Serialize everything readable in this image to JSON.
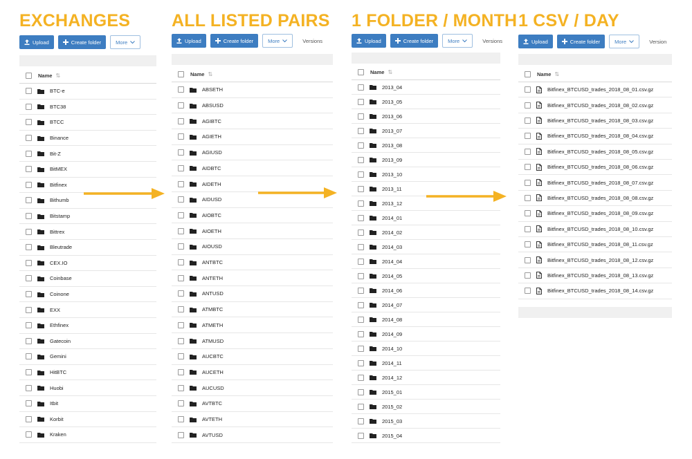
{
  "panels": [
    {
      "title": "EXCHANGES",
      "upload": "Upload",
      "create_folder": "Create folder",
      "more": "More",
      "versions": "",
      "name_header": "Name",
      "item_icon": "folder-icon",
      "items": [
        "BTC-e",
        "BTC38",
        "BTCC",
        "Binance",
        "Bit-Z",
        "BitMEX",
        "Bitfinex",
        "Bithumb",
        "Bitstamp",
        "Bittrex",
        "Bleutrade",
        "CEX.IO",
        "Coinbase",
        "Coinone",
        "EXX",
        "Ethfinex",
        "Gatecoin",
        "Gemini",
        "HitBTC",
        "Huobi",
        "Itbit",
        "Korbit",
        "Kraken"
      ]
    },
    {
      "title": "ALL LISTED PAIRS",
      "upload": "Upload",
      "create_folder": "Create folder",
      "more": "More",
      "versions": "Versions",
      "name_header": "Name",
      "item_icon": "folder-icon",
      "items": [
        "ABSETH",
        "ABSUSD",
        "AGIBTC",
        "AGIETH",
        "AGIUSD",
        "AIDBTC",
        "AIDETH",
        "AIDUSD",
        "AIOBTC",
        "AIOETH",
        "AIOUSD",
        "ANTBTC",
        "ANTETH",
        "ANTUSD",
        "ATMBTC",
        "ATMETH",
        "ATMUSD",
        "AUCBTC",
        "AUCETH",
        "AUCUSD",
        "AVTBTC",
        "AVTETH",
        "AVTUSD"
      ]
    },
    {
      "title": "1 FOLDER / MONTH",
      "upload": "Upload",
      "create_folder": "Create folder",
      "more": "More",
      "versions": "Versions",
      "name_header": "Name",
      "item_icon": "folder-icon",
      "items": [
        "2013_04",
        "2013_05",
        "2013_06",
        "2013_07",
        "2013_08",
        "2013_09",
        "2013_10",
        "2013_11",
        "2013_12",
        "2014_01",
        "2014_02",
        "2014_03",
        "2014_04",
        "2014_05",
        "2014_06",
        "2014_07",
        "2014_08",
        "2014_09",
        "2014_10",
        "2014_11",
        "2014_12",
        "2015_01",
        "2015_02",
        "2015_03",
        "2015_04"
      ]
    },
    {
      "title": "1 CSV / DAY",
      "upload": "Upload",
      "create_folder": "Create folder",
      "more": "More",
      "versions": "Version",
      "name_header": "Name",
      "item_icon": "file-icon",
      "items": [
        "Bitfinex_BTCUSD_trades_2018_08_01.csv.gz",
        "Bitfinex_BTCUSD_trades_2018_08_02.csv.gz",
        "Bitfinex_BTCUSD_trades_2018_08_03.csv.gz",
        "Bitfinex_BTCUSD_trades_2018_08_04.csv.gz",
        "Bitfinex_BTCUSD_trades_2018_08_05.csv.gz",
        "Bitfinex_BTCUSD_trades_2018_08_06.csv.gz",
        "Bitfinex_BTCUSD_trades_2018_08_07.csv.gz",
        "Bitfinex_BTCUSD_trades_2018_08_08.csv.gz",
        "Bitfinex_BTCUSD_trades_2018_08_09.csv.gz",
        "Bitfinex_BTCUSD_trades_2018_08_10.csv.gz",
        "Bitfinex_BTCUSD_trades_2018_08_11.csv.gz",
        "Bitfinex_BTCUSD_trades_2018_08_12.csv.gz",
        "Bitfinex_BTCUSD_trades_2018_08_13.csv.gz",
        "Bitfinex_BTCUSD_trades_2018_08_14.csv.gz"
      ]
    }
  ],
  "colors": {
    "title": "#f4b223",
    "arrow": "#f4b223",
    "button": "#3d7dc1"
  },
  "icons": {
    "upload": "upload-icon",
    "create_folder": "plus-icon",
    "more": "chevron-down-icon",
    "sort": "sort-icon",
    "arrow": "arrow-right-icon"
  }
}
